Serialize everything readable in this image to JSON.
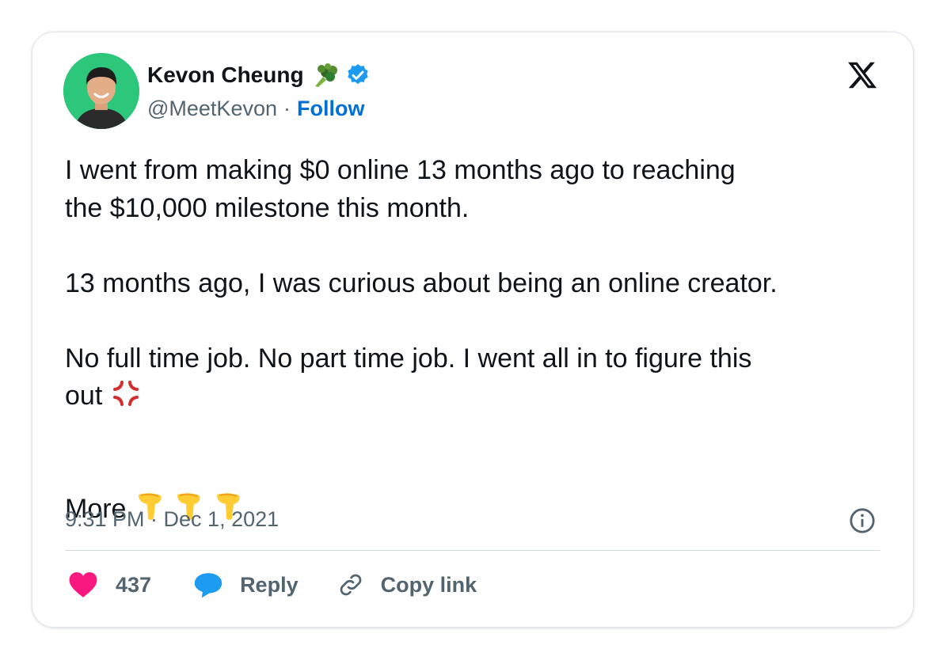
{
  "author": {
    "name": "Kevon Cheung",
    "handle": "@MeetKevon",
    "separator": "·",
    "follow_label": "Follow",
    "name_emoji": "broccoli",
    "verified": true
  },
  "tweet": {
    "line1": "I went from making $0 online 13 months ago to reaching",
    "line2": "the $10,000 milestone this month.",
    "line3": "13 months ago, I was curious about being an online creator.",
    "line4": "No full time job. No part time job. I went all in to figure this",
    "line5": "out",
    "line6": "More",
    "emojis": [
      "anger-symbol",
      "pointing-down",
      "pointing-down",
      "pointing-down"
    ]
  },
  "meta": {
    "timestamp": "9:31 PM · Dec 1, 2021"
  },
  "actions": {
    "likes_count": "437",
    "reply_label": "Reply",
    "copy_link_label": "Copy link"
  },
  "colors": {
    "like": "#f91880",
    "reply": "#1d9bf0",
    "verified": "#1d9bf0",
    "follow": "#006fd6",
    "secondary_text": "#536471",
    "avatar_bg": "#2dc77b"
  }
}
